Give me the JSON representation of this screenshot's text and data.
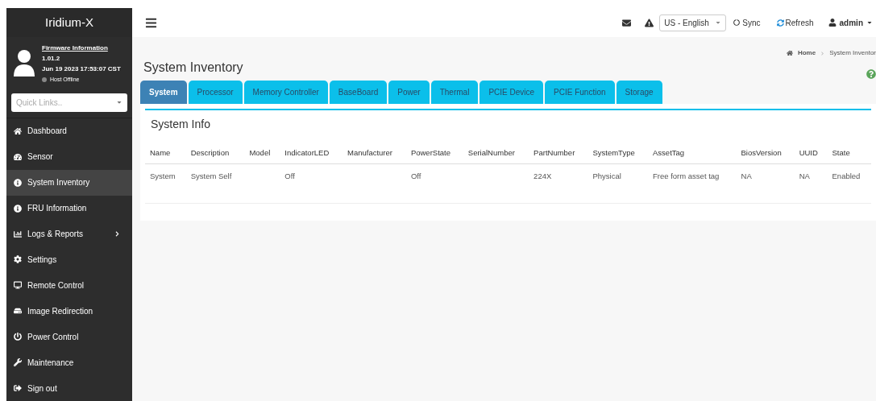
{
  "sidebar": {
    "brand": "Iridium-X",
    "firmware_link": "Firmware Information",
    "version": "1.01.2",
    "build_date": "Jun 19 2023 17:53:07 CST",
    "host_status": "Host Offline",
    "quick_links": {
      "placeholder": "Quick Links.."
    },
    "items": [
      {
        "label": "Dashboard",
        "selected": false,
        "submenu": false
      },
      {
        "label": "Sensor",
        "selected": false,
        "submenu": false
      },
      {
        "label": "System Inventory",
        "selected": true,
        "submenu": false
      },
      {
        "label": "FRU Information",
        "selected": false,
        "submenu": false
      },
      {
        "label": "Logs & Reports",
        "selected": false,
        "submenu": true
      },
      {
        "label": "Settings",
        "selected": false,
        "submenu": false
      },
      {
        "label": "Remote Control",
        "selected": false,
        "submenu": false
      },
      {
        "label": "Image Redirection",
        "selected": false,
        "submenu": false
      },
      {
        "label": "Power Control",
        "selected": false,
        "submenu": false
      },
      {
        "label": "Maintenance",
        "selected": false,
        "submenu": false
      },
      {
        "label": "Sign out",
        "selected": false,
        "submenu": false
      }
    ]
  },
  "header": {
    "language": "US - English",
    "sync": "Sync",
    "refresh": "Refresh",
    "user": "admin"
  },
  "page": {
    "title": "System Inventory",
    "breadcrumb": [
      "Home",
      "System Inventor"
    ]
  },
  "tabs": [
    {
      "label": "System",
      "selected": true
    },
    {
      "label": "Processor",
      "selected": false
    },
    {
      "label": "Memory Controller",
      "selected": false
    },
    {
      "label": "BaseBoard",
      "selected": false
    },
    {
      "label": "Power",
      "selected": false
    },
    {
      "label": "Thermal",
      "selected": false
    },
    {
      "label": "PCIE Device",
      "selected": false
    },
    {
      "label": "PCIE Function",
      "selected": false
    },
    {
      "label": "Storage",
      "selected": false
    }
  ],
  "panel": {
    "title": "System Info",
    "table": {
      "columns": [
        "Name",
        "Description",
        "Model",
        "IndicatorLED",
        "Manufacturer",
        "PowerState",
        "SerialNumber",
        "PartNumber",
        "SystemType",
        "AssetTag",
        "BiosVersion",
        "UUID",
        "State"
      ],
      "rows": [
        [
          "System",
          "System Self",
          "",
          "Off",
          "",
          "Off",
          "",
          "224X",
          "Physical",
          "Free form asset tag",
          "NA",
          "NA",
          "Enabled"
        ]
      ]
    }
  }
}
